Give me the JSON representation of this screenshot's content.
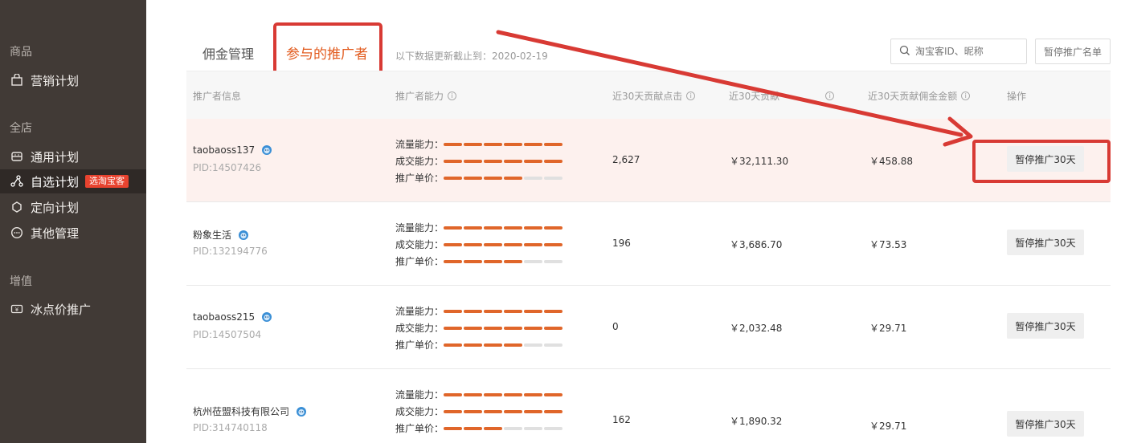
{
  "sidebar": {
    "sections": [
      {
        "title": "商品",
        "items": [
          {
            "label": "营销计划",
            "icon": "bag-icon"
          }
        ]
      },
      {
        "title": "全店",
        "items": [
          {
            "label": "通用计划",
            "icon": "store-icon"
          },
          {
            "label": "自选计划",
            "icon": "nodes-icon",
            "badge": "选淘宝客",
            "active": true
          },
          {
            "label": "定向计划",
            "icon": "target-icon"
          },
          {
            "label": "其他管理",
            "icon": "more-icon"
          }
        ]
      },
      {
        "title": "增值",
        "items": [
          {
            "label": "冰点价推广",
            "icon": "yen-icon"
          }
        ]
      }
    ]
  },
  "tabs": [
    "佣金管理",
    "参与的推广者"
  ],
  "active_tab": "参与的推广者",
  "updated_text": "以下数据更新截止到：2020-02-19",
  "search": {
    "placeholder": "淘宝客ID、昵称"
  },
  "pause_list_label": "暂停推广名单",
  "table": {
    "headers": [
      "推广者信息",
      "推广者能力",
      "近30天贡献点击",
      "近30天贡献成交金额",
      "近30天贡献佣金金额",
      "操作"
    ],
    "header_visible": [
      "推广者信息",
      "推广者能力",
      "近30天贡献点击",
      "近30天贡献",
      "近30天贡献佣金金额",
      "操作"
    ],
    "ability_labels": [
      "流量能力：",
      "成交能力：",
      "推广单价："
    ],
    "rows": [
      {
        "name": "taobaoss137",
        "pid": "PID:14507426",
        "ability": [
          6,
          6,
          4
        ],
        "clicks": "2,627",
        "amount": "￥32,111.30",
        "commission": "￥458.88",
        "action": "暂停推广30天"
      },
      {
        "name": "粉象生活",
        "pid": "PID:132194776",
        "ability": [
          6,
          6,
          4
        ],
        "clicks": "196",
        "amount": "￥3,686.70",
        "commission": "￥73.53",
        "action": "暂停推广30天"
      },
      {
        "name": "taobaoss215",
        "pid": "PID:14507504",
        "ability": [
          6,
          6,
          4
        ],
        "clicks": "0",
        "amount": "￥2,032.48",
        "commission": "￥29.71",
        "action": "暂停推广30天"
      },
      {
        "name": "杭州莅盟科技有限公司",
        "pid": "PID:314740118",
        "ability": [
          6,
          6,
          3
        ],
        "clicks": "162",
        "amount": "￥1,890.32",
        "commission": "￥29.71",
        "action": "暂停推广30天"
      }
    ]
  },
  "accent_color": "#e0662a",
  "annotation_color": "#d83a34"
}
